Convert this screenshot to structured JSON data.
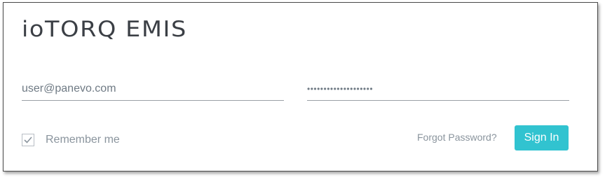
{
  "app": {
    "logo_text": "ioTORQ EMIS"
  },
  "login_form": {
    "username": {
      "value": "user@panevo.com",
      "placeholder": ""
    },
    "password": {
      "value": "••••••••••••••••••••",
      "placeholder": ""
    },
    "remember_me": {
      "label": "Remember me",
      "checked": true
    },
    "forgot_password_label": "Forgot Password?",
    "sign_in_label": "Sign In"
  },
  "colors": {
    "accent": "#31c3d0",
    "logo_text": "#3b3f45",
    "muted_text": "#8a949d",
    "border": "#9aa0a6"
  },
  "icons": {
    "checkbox_mark": "check-icon"
  }
}
